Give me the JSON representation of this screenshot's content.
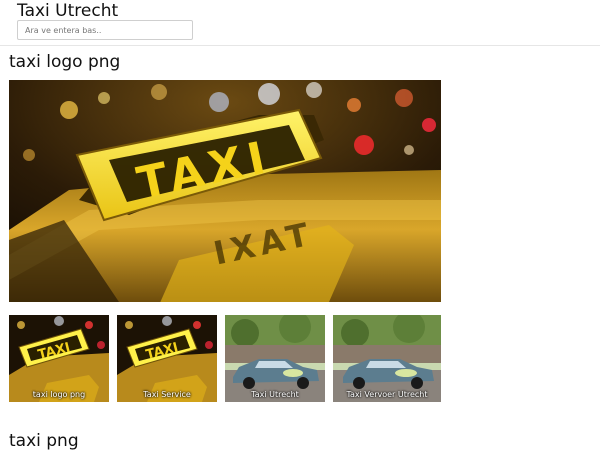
{
  "header": {
    "site_title": "Taxi Utrecht",
    "search_placeholder": "Ara ve entera bas.."
  },
  "sections": [
    {
      "title": "taxi logo png"
    },
    {
      "title": "taxi png"
    }
  ],
  "hero_image": {
    "sign_text": "TAXI",
    "reflection_text": "TAXI"
  },
  "thumbnails": [
    {
      "caption": "taxi logo png",
      "sign_text": "TAXI"
    },
    {
      "caption": "Taxi Service",
      "sign_text": "TAXI"
    },
    {
      "caption": "Taxi Utrecht"
    },
    {
      "caption": "Taxi Vervoer Utrecht"
    }
  ],
  "colors": {
    "taxi_sign": "#f5d21a",
    "sign_text": "#2a2000",
    "car_body": "#5c7d8f"
  }
}
